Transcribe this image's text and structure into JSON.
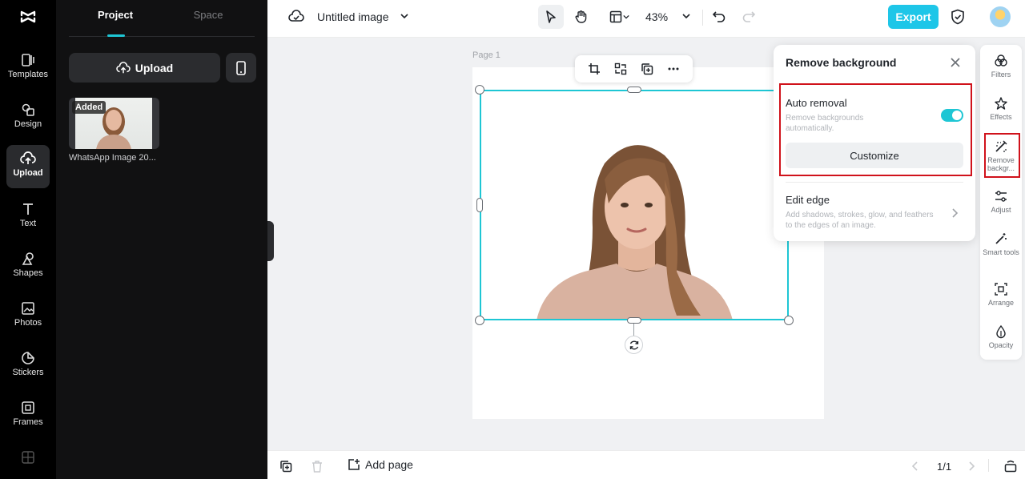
{
  "sidebar": {
    "items": [
      {
        "label": "Templates",
        "icon": "templates-icon"
      },
      {
        "label": "Design",
        "icon": "design-icon"
      },
      {
        "label": "Upload",
        "icon": "upload-cloud-icon"
      },
      {
        "label": "Text",
        "icon": "text-icon"
      },
      {
        "label": "Shapes",
        "icon": "shapes-icon"
      },
      {
        "label": "Photos",
        "icon": "photos-icon"
      },
      {
        "label": "Stickers",
        "icon": "stickers-icon"
      },
      {
        "label": "Frames",
        "icon": "frames-icon"
      }
    ],
    "active": "Upload"
  },
  "panel": {
    "tabs": [
      {
        "label": "Project"
      },
      {
        "label": "Space"
      }
    ],
    "active_tab": "Project",
    "upload_label": "Upload",
    "media": [
      {
        "badge": "Added",
        "name": "WhatsApp Image 20..."
      }
    ]
  },
  "topbar": {
    "title": "Untitled image",
    "zoom": "43%",
    "export_label": "Export"
  },
  "canvas": {
    "page_label": "Page 1"
  },
  "remove_bg_panel": {
    "title": "Remove background",
    "auto_removal": {
      "label": "Auto removal",
      "description": "Remove backgrounds automatically.",
      "enabled": true
    },
    "customize_label": "Customize",
    "edit_edge": {
      "label": "Edit edge",
      "description": "Add shadows, strokes, glow, and feathers to the edges of an image."
    }
  },
  "right_tools": [
    {
      "label": "Filters",
      "icon": "filters-icon"
    },
    {
      "label": "Effects",
      "icon": "effects-icon"
    },
    {
      "label": "Remove backgr...",
      "icon": "remove-background-icon",
      "highlighted": true
    },
    {
      "label": "Adjust",
      "icon": "adjust-icon"
    },
    {
      "label": "Smart tools",
      "icon": "smart-tools-icon"
    },
    {
      "label": "Arrange",
      "icon": "arrange-icon"
    },
    {
      "label": "Opacity",
      "icon": "opacity-icon"
    }
  ],
  "bottombar": {
    "add_page_label": "Add page",
    "page_count": "1/1"
  },
  "colors": {
    "accent": "#1ec6d4",
    "export": "#1ec6e8",
    "highlight": "#d0121b"
  }
}
